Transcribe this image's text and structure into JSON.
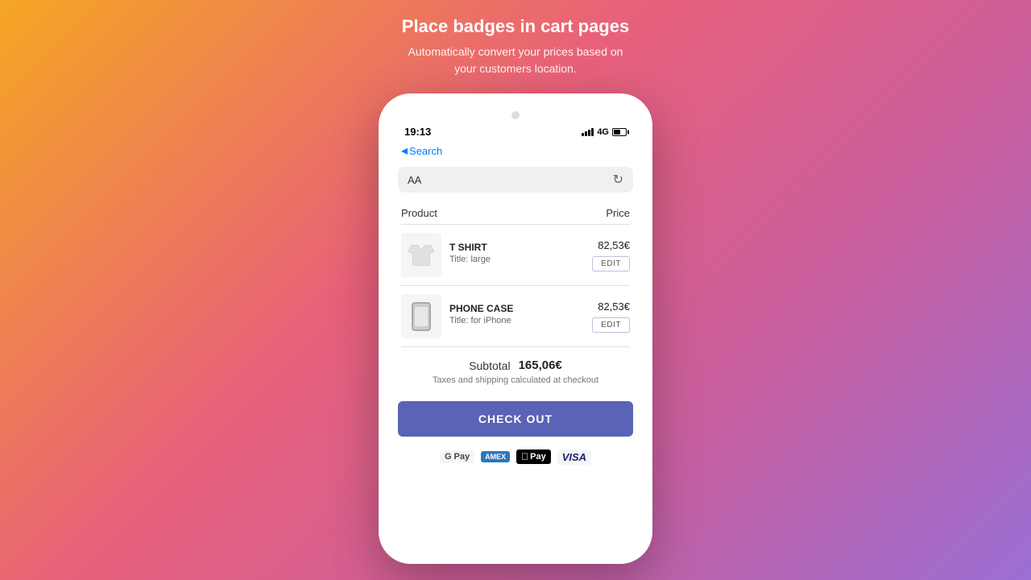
{
  "header": {
    "title": "Place badges in cart pages",
    "subtitle": "Automatically convert your prices based on\nyour customers location."
  },
  "phone": {
    "status_bar": {
      "time": "19:13",
      "network": "4G"
    },
    "nav": {
      "back_label": "Search"
    },
    "browser": {
      "aa_label": "AA"
    },
    "cart": {
      "column_product": "Product",
      "column_price": "Price",
      "items": [
        {
          "name": "T SHIRT",
          "variant": "Title: large",
          "price": "82,53€",
          "edit_label": "EDIT",
          "type": "tshirt"
        },
        {
          "name": "PHONE CASE",
          "variant": "Title: for iPhone",
          "price": "82,53€",
          "edit_label": "EDIT",
          "type": "phonecase"
        }
      ],
      "subtotal_label": "Subtotal",
      "subtotal_value": "165,06€",
      "tax_note": "Taxes and shipping calculated at checkout",
      "checkout_label": "CHECK OUT",
      "payment_methods": [
        "Google Pay",
        "Amex",
        "Apple Pay",
        "Visa"
      ]
    }
  }
}
